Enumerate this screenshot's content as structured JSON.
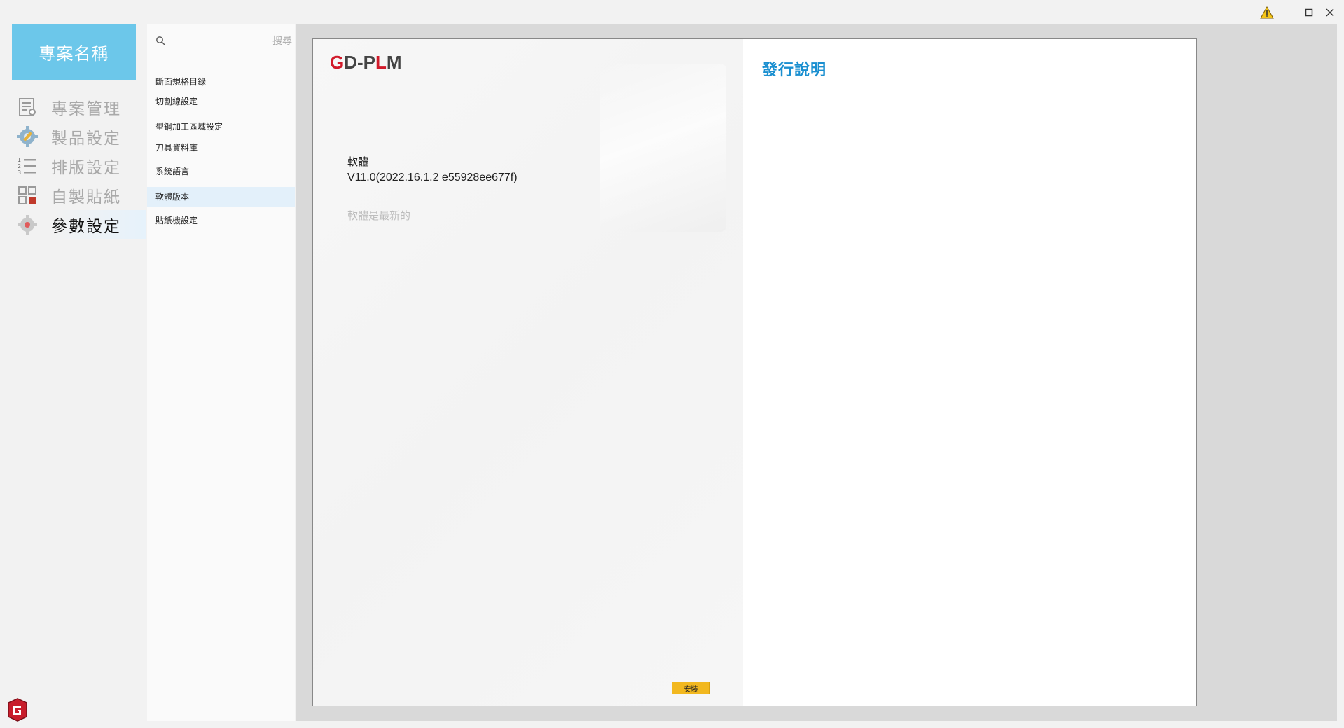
{
  "window": {
    "controls": [
      {
        "name": "warning-icon",
        "color": "#e0a800"
      },
      {
        "name": "minimize-icon"
      },
      {
        "name": "maximize-icon"
      },
      {
        "name": "close-icon"
      }
    ]
  },
  "sidebar": {
    "project_name": "專案名稱",
    "items": [
      {
        "label": "專案管理",
        "icon": "document-gear-icon",
        "active": false
      },
      {
        "label": "製品設定",
        "icon": "product-settings-icon",
        "active": false
      },
      {
        "label": "排版設定",
        "icon": "numbered-list-icon",
        "active": false
      },
      {
        "label": "自製貼紙",
        "icon": "grid-sticker-icon",
        "active": false
      },
      {
        "label": "參數設定",
        "icon": "gear-icon",
        "active": true
      }
    ]
  },
  "submenu": {
    "search_placeholder": "搜尋",
    "items": [
      {
        "label": "斷面規格目錄",
        "active": false
      },
      {
        "label": "切割線設定",
        "active": false
      },
      {
        "label": "型鋼加工區域設定",
        "active": false
      },
      {
        "label": "刀具資料庫",
        "active": false
      },
      {
        "label": "系統語言",
        "active": false
      },
      {
        "label": "軟體版本",
        "active": true
      },
      {
        "label": "貼紙機設定",
        "active": false
      }
    ]
  },
  "content": {
    "brand_g": "G",
    "brand_d": "D-P",
    "brand_l": "L",
    "brand_m": "M",
    "software_label": "軟體",
    "version": "V11.0(2022.16.1.2 e55928ee677f)",
    "status": "軟體是最新的",
    "install_label": "安裝",
    "release_notes_title": "發行說明"
  },
  "colors": {
    "accent_tile": "#6cc7ea",
    "release_title": "#1a8fd0",
    "install_button": "#f2b81f",
    "brand_red": "#d11a2a"
  }
}
